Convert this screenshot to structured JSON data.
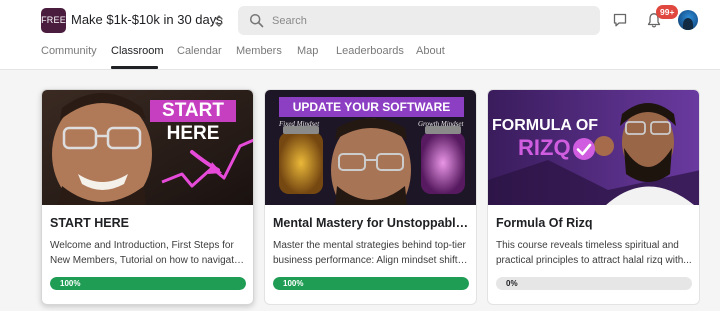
{
  "header": {
    "logo_text": "FREE",
    "group_name": "Make $1k-$10k in 30 days",
    "search_placeholder": "Search",
    "notification_count": "99+",
    "colors": {
      "logo_bg": "#4a1d3f",
      "badge": "#e0473e",
      "progress": "#1f9d55"
    }
  },
  "nav": {
    "tabs": [
      {
        "label": "Community",
        "active": false
      },
      {
        "label": "Classroom",
        "active": true
      },
      {
        "label": "Calendar",
        "active": false
      },
      {
        "label": "Members",
        "active": false
      },
      {
        "label": "Map",
        "active": false
      },
      {
        "label": "Leaderboards",
        "active": false
      },
      {
        "label": "About",
        "active": false
      }
    ]
  },
  "courses": [
    {
      "thumbnail_text": [
        "START",
        "HERE"
      ],
      "title": "START HERE",
      "description_lines": [
        "Welcome and Introduction, First Steps for",
        "New Members, Tutorial on how to navigate..."
      ],
      "progress_label": "100%",
      "progress": 1.0
    },
    {
      "thumbnail_text": [
        "UPDATE YOUR SOFTWARE",
        "Fixed Mindset",
        "Growth Mindset"
      ],
      "title": "Mental Mastery for Unstoppable ...",
      "description_lines": [
        "Master the mental strategies behind top-tier",
        "business performance: Align mindset shifts..."
      ],
      "progress_label": "100%",
      "progress": 1.0
    },
    {
      "thumbnail_text": [
        "FORMULA OF",
        "RIZQ"
      ],
      "title": "Formula Of Rizq",
      "description_lines": [
        "This course reveals timeless spiritual and",
        "practical principles to attract halal rizq with..."
      ],
      "progress_label": "0%",
      "progress": 0.0
    }
  ]
}
